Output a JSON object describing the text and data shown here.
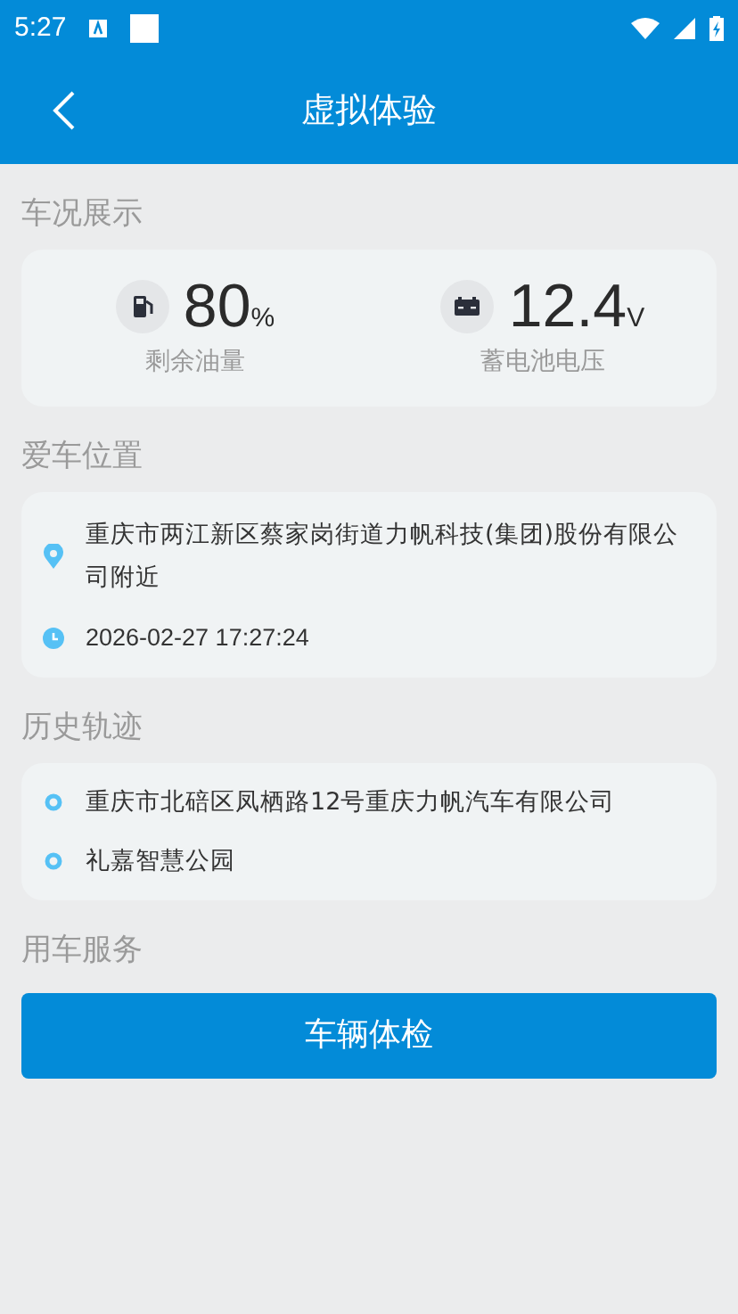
{
  "status_bar": {
    "time": "5:27"
  },
  "header": {
    "title": "虚拟体验"
  },
  "vehicle_status": {
    "title": "车况展示",
    "stats": [
      {
        "kind": "fuel",
        "value": "80",
        "unit": "%",
        "label": "剩余油量"
      },
      {
        "kind": "battery",
        "value": "12.4",
        "unit": "V",
        "label": "蓄电池电压"
      }
    ]
  },
  "location": {
    "title": "爱车位置",
    "address": "重庆市两江新区蔡家岗街道力帆科技(集团)股份有限公司附近",
    "time": "2026-02-27 17:27:24"
  },
  "history": {
    "title": "历史轨迹",
    "items": [
      "重庆市北碚区凤栖路12号重庆力帆汽车有限公司",
      "礼嘉智慧公园"
    ]
  },
  "services": {
    "title": "用车服务",
    "button": "车辆体检"
  }
}
